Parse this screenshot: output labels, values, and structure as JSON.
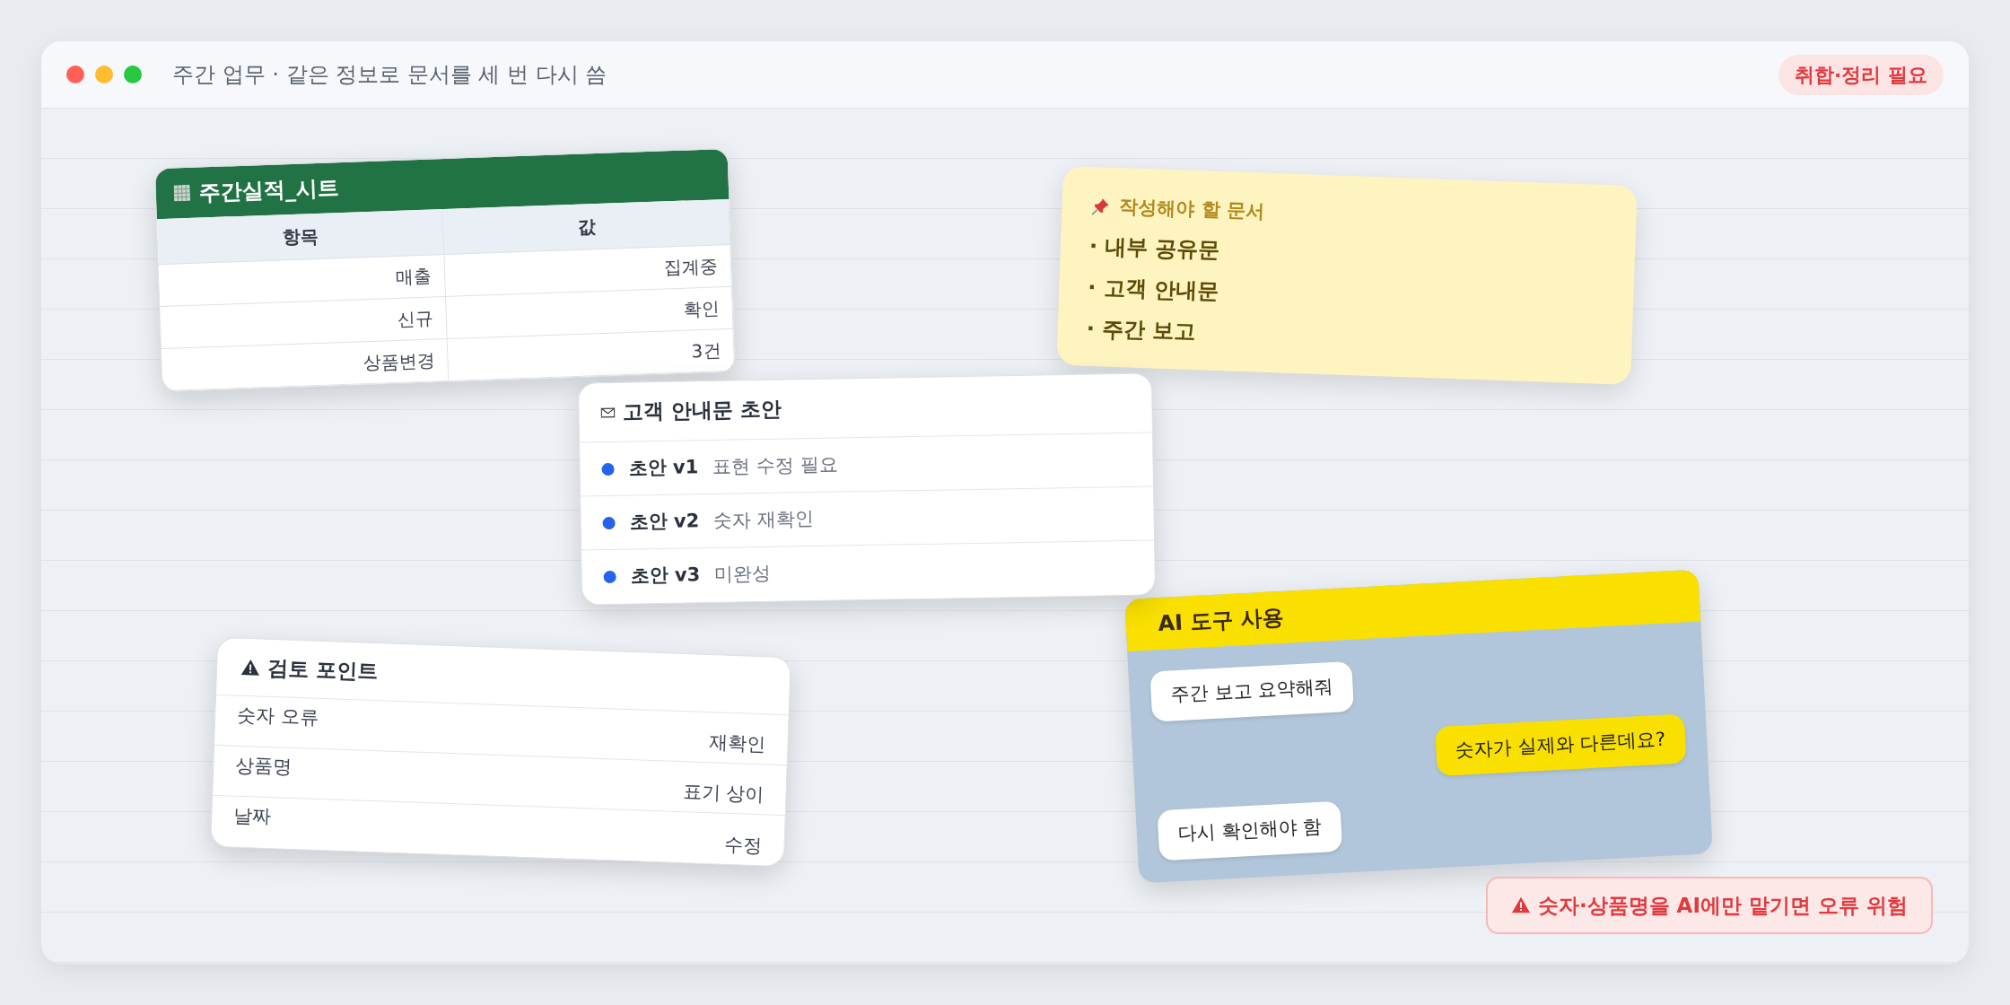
{
  "window": {
    "title": "주간 업무 · 같은 정보로 문서를 세 번 다시 씀",
    "badge": "취합·정리 필요"
  },
  "sheet": {
    "title": "주간실적_시트",
    "columns": [
      "항목",
      "값"
    ],
    "rows": [
      [
        "매출",
        "집계중"
      ],
      [
        "신규",
        "확인"
      ],
      [
        "상품변경",
        "3건"
      ]
    ]
  },
  "sticky_note": {
    "title": "작성해야 할 문서",
    "items": [
      "· 내부 공유문",
      "· 고객 안내문",
      "· 주간 보고"
    ]
  },
  "draft_card": {
    "title": "고객 안내문 초안",
    "items": [
      {
        "label": "초안 v1",
        "note": "표현 수정 필요",
        "color": "#2563eb"
      },
      {
        "label": "초안 v2",
        "note": "숫자 재확인",
        "color": "#2563eb"
      },
      {
        "label": "초안 v3",
        "note": "미완성",
        "color": "#2563eb"
      }
    ]
  },
  "review_card": {
    "title": "검토 포인트",
    "rows": [
      {
        "item": "숫자 오류",
        "status": "재확인"
      },
      {
        "item": "상품명",
        "status": "표기 상이"
      },
      {
        "item": "날짜",
        "status": "수정"
      }
    ]
  },
  "ai_chat": {
    "title": "AI 도구 사용",
    "messages": [
      {
        "kind": "incoming",
        "text": "주간 보고 요약해줘"
      },
      {
        "kind": "outgoing",
        "text": "숫자가 실제와 다른데요?"
      },
      {
        "kind": "incoming",
        "text": "다시 확인해야 함"
      }
    ]
  },
  "warning": "숫자·상품명을 AI에만 맡기면 오류 위험"
}
